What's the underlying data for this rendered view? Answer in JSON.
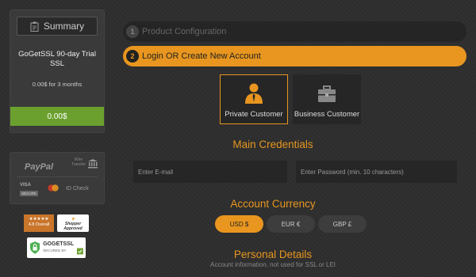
{
  "summary": {
    "title": "Summary",
    "product_name": "GoGetSSL 90-day Trial SSL",
    "price_line": "0.00$ for 3 months",
    "total": "0.00$"
  },
  "payment": {
    "paypal": "PayPal",
    "wire_transfer": "Wire Transfer",
    "visa": "VISA",
    "secure": "SECURE",
    "id_check": "ID Check"
  },
  "badges": {
    "rating": "4.8 Overall",
    "rating_stars": "★★★★★",
    "shopper": "Shopper Approved",
    "gogetssl": "GOGETSSL",
    "secured_by": "SECURED BY"
  },
  "steps": [
    {
      "num": "1",
      "label": "Product Configuration"
    },
    {
      "num": "2",
      "label": "Login OR Create New Account"
    }
  ],
  "customer_types": [
    {
      "label": "Private Customer",
      "active": true
    },
    {
      "label": "Business Customer",
      "active": false
    }
  ],
  "main_credentials": {
    "title": "Main Credentials",
    "email_placeholder": "Enter E-mail",
    "password_placeholder": "Enter Password (min. 10 characters)"
  },
  "currency": {
    "title": "Account Currency",
    "options": [
      "USD $",
      "EUR €",
      "GBP £"
    ],
    "selected": "USD $"
  },
  "personal": {
    "title": "Personal Details",
    "note": "Account information, not used for SSL or LEI"
  },
  "colors": {
    "accent": "#e8961f",
    "success": "#6ba02e",
    "panel": "#3a3a3a",
    "background": "#2e2e2e"
  }
}
